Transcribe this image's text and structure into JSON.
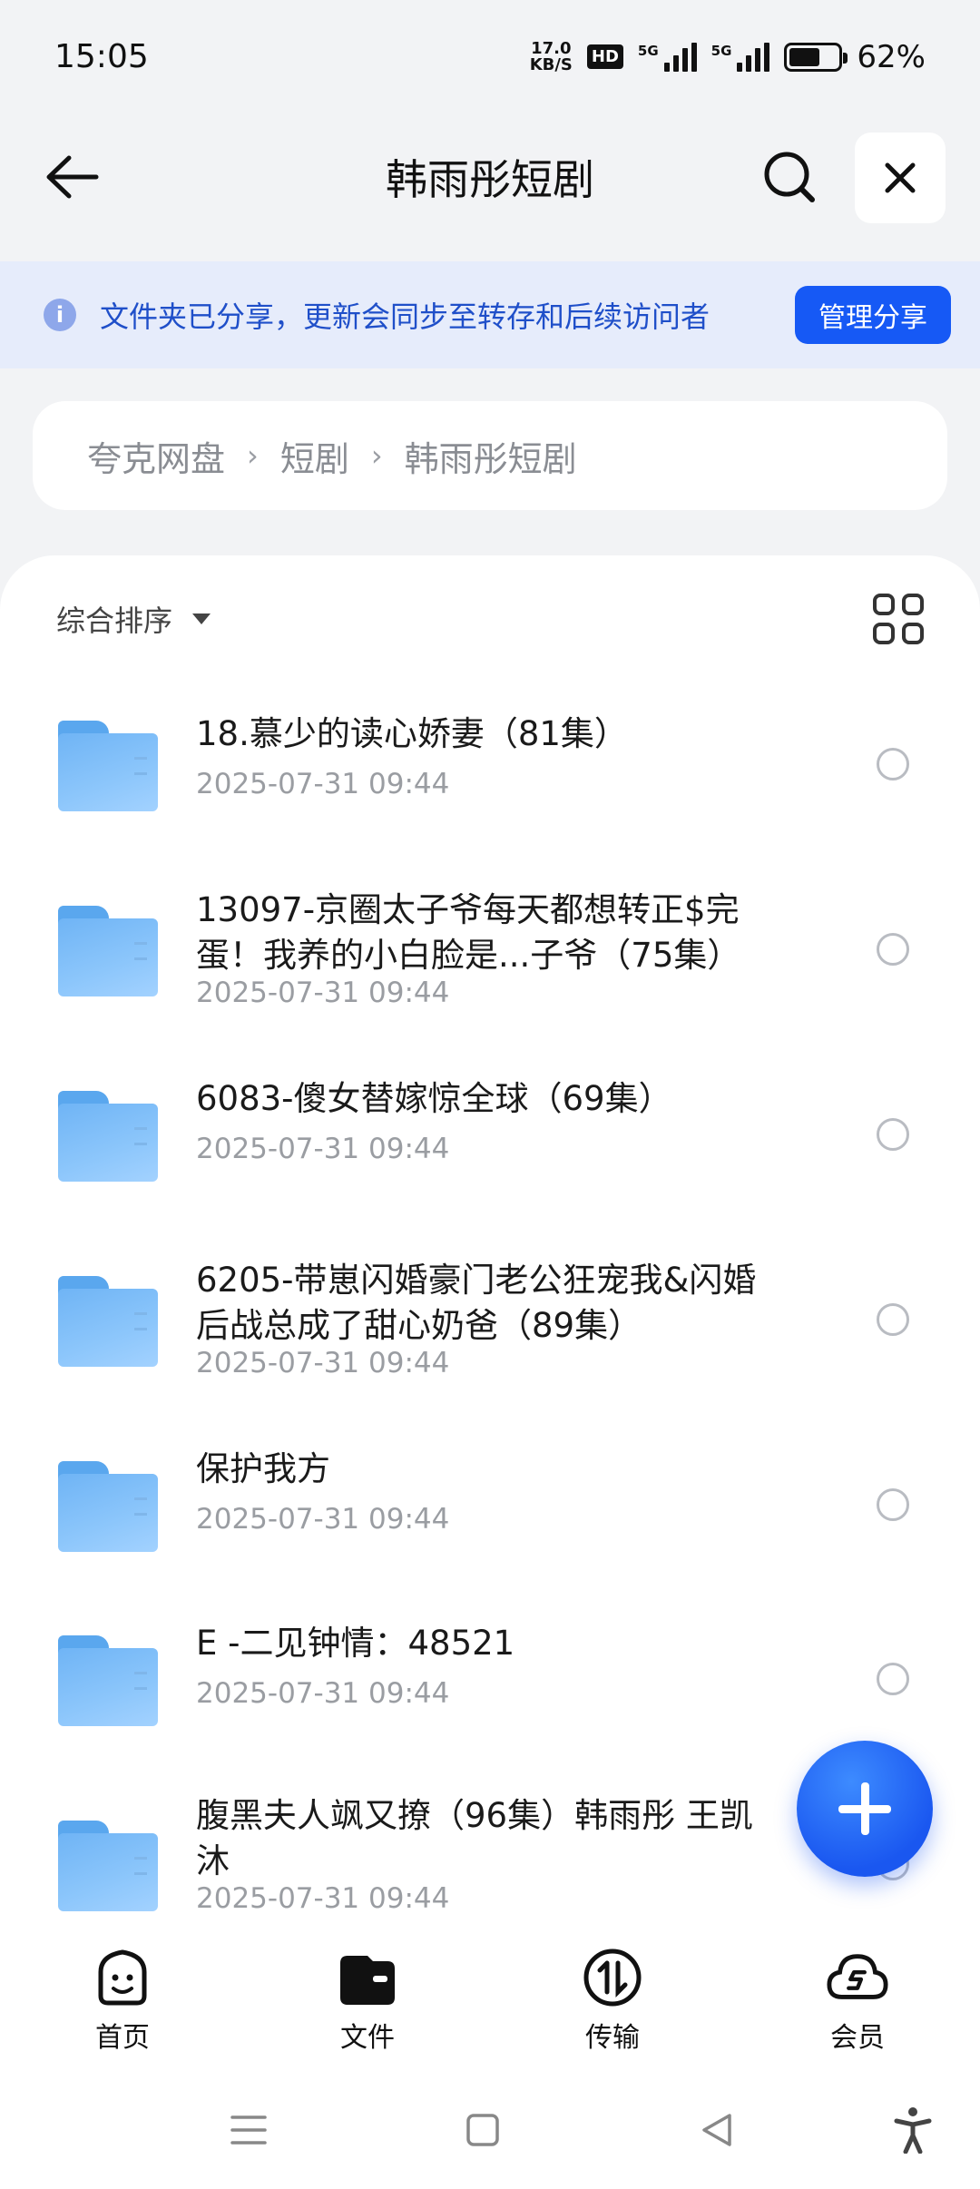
{
  "status": {
    "time": "15:05",
    "net_speed_value": "17.0",
    "net_speed_unit": "KB/S",
    "hd_label": "HD",
    "sig1_label": "5G",
    "sig2_label": "5G",
    "battery": "62%",
    "battery_level": 0.62
  },
  "header": {
    "title": "韩雨彤短剧"
  },
  "notice": {
    "text": "文件夹已分享，更新会同步至转存和后续访问者",
    "manage_button": "管理分享"
  },
  "breadcrumb": [
    "夸克网盘",
    "短剧",
    "韩雨彤短剧"
  ],
  "sort": {
    "label": "综合排序"
  },
  "files": [
    {
      "name": "18.慕少的读心娇妻（81集）",
      "date": "2025-07-31 09:44"
    },
    {
      "name": "13097-京圈太子爷每天都想转正$完蛋！我养的小白脸是...子爷（75集）",
      "date": "2025-07-31 09:44"
    },
    {
      "name": "6083-傻女替嫁惊全球（69集）",
      "date": "2025-07-31 09:44"
    },
    {
      "name": "6205-带崽闪婚豪门老公狂宠我&闪婚后战总成了甜心奶爸（89集）",
      "date": "2025-07-31 09:44"
    },
    {
      "name": "保护我方",
      "date": "2025-07-31 09:44"
    },
    {
      "name": "E -二见钟情：48521",
      "date": "2025-07-31 09:44"
    },
    {
      "name": "腹黑夫人飒又撩（96集）韩雨彤 王凯沐",
      "date": "2025-07-31 09:44"
    }
  ],
  "tabs": [
    {
      "label": "首页",
      "icon": "smile-face-icon"
    },
    {
      "label": "文件",
      "icon": "wallet-folder-icon"
    },
    {
      "label": "传输",
      "icon": "transfer-icon"
    },
    {
      "label": "会员",
      "icon": "cloud-member-icon"
    }
  ],
  "colors": {
    "accent": "#1659f5",
    "notice_bg": "#e6ecfb",
    "notice_text": "#1f4fc9"
  }
}
